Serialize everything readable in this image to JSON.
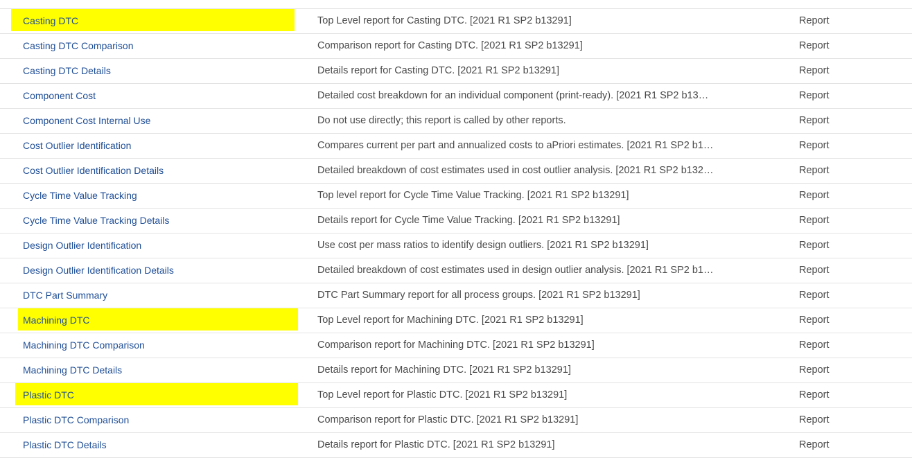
{
  "rows": [
    {
      "name": "Casting DTC",
      "description": "Top Level report for Casting DTC. [2021 R1 SP2 b13291]",
      "type": "Report",
      "highlighted": true
    },
    {
      "name": "Casting DTC Comparison",
      "description": "Comparison report for Casting DTC. [2021 R1 SP2 b13291]",
      "type": "Report",
      "highlighted": false
    },
    {
      "name": "Casting DTC Details",
      "description": "Details report for Casting DTC. [2021 R1 SP2 b13291]",
      "type": "Report",
      "highlighted": false
    },
    {
      "name": "Component Cost",
      "description": "Detailed cost breakdown for an individual component (print-ready). [2021 R1 SP2 b13…",
      "type": "Report",
      "highlighted": false
    },
    {
      "name": "Component Cost Internal Use",
      "description": "Do not use directly; this report is called by other reports.",
      "type": "Report",
      "highlighted": false
    },
    {
      "name": "Cost Outlier Identification",
      "description": "Compares current per part and annualized costs to aPriori estimates. [2021 R1 SP2 b1…",
      "type": "Report",
      "highlighted": false
    },
    {
      "name": "Cost Outlier Identification Details",
      "description": "Detailed breakdown of cost estimates used in cost outlier analysis. [2021 R1 SP2 b132…",
      "type": "Report",
      "highlighted": false
    },
    {
      "name": "Cycle Time Value Tracking",
      "description": "Top level report for Cycle Time Value Tracking. [2021 R1 SP2 b13291]",
      "type": "Report",
      "highlighted": false
    },
    {
      "name": "Cycle Time Value Tracking Details",
      "description": "Details report for Cycle Time Value Tracking. [2021 R1 SP2 b13291]",
      "type": "Report",
      "highlighted": false
    },
    {
      "name": "Design Outlier Identification",
      "description": "Use cost per mass ratios to identify design outliers. [2021 R1 SP2 b13291]",
      "type": "Report",
      "highlighted": false
    },
    {
      "name": "Design Outlier Identification Details",
      "description": "Detailed breakdown of cost estimates used in design outlier analysis. [2021 R1 SP2 b1…",
      "type": "Report",
      "highlighted": false
    },
    {
      "name": "DTC Part Summary",
      "description": "DTC Part Summary report for all process groups. [2021 R1 SP2 b13291]",
      "type": "Report",
      "highlighted": false
    },
    {
      "name": "Machining DTC",
      "description": "Top Level report for Machining DTC. [2021 R1 SP2 b13291]",
      "type": "Report",
      "highlighted": true
    },
    {
      "name": "Machining DTC Comparison",
      "description": "Comparison report for Machining DTC. [2021 R1 SP2 b13291]",
      "type": "Report",
      "highlighted": false
    },
    {
      "name": "Machining DTC Details",
      "description": "Details report for Machining DTC. [2021 R1 SP2 b13291]",
      "type": "Report",
      "highlighted": false
    },
    {
      "name": "Plastic DTC",
      "description": "Top Level report for Plastic DTC. [2021 R1 SP2 b13291]",
      "type": "Report",
      "highlighted": true
    },
    {
      "name": "Plastic DTC Comparison",
      "description": "Comparison report for Plastic DTC. [2021 R1 SP2 b13291]",
      "type": "Report",
      "highlighted": false
    },
    {
      "name": "Plastic DTC Details",
      "description": "Details report for Plastic DTC. [2021 R1 SP2 b13291]",
      "type": "Report",
      "highlighted": false
    }
  ],
  "colors": {
    "link": "#1f4e96",
    "text": "#4a4a4a",
    "highlight": "#ffff00",
    "divider": "#e3e3e3"
  }
}
